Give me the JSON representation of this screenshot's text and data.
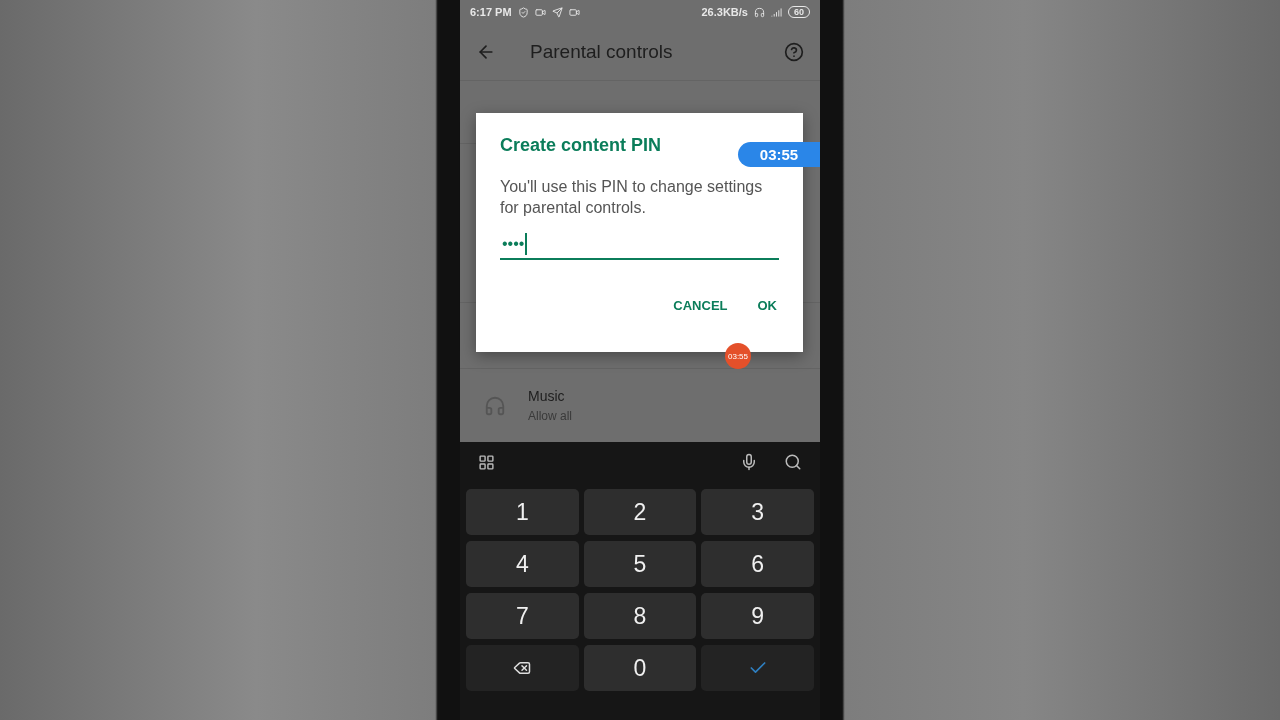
{
  "status_bar": {
    "time": "6:17 PM",
    "speed": "26.3KB/s",
    "battery": "60"
  },
  "app_bar": {
    "title": "Parental controls"
  },
  "list": [
    {
      "title": "Music",
      "subtitle": "Allow all"
    }
  ],
  "dialog": {
    "title": "Create content PIN",
    "message": "You'll use this PIN to change settings for parental controls.",
    "pin_value": "••••",
    "buttons": [
      "CANCEL",
      "OK"
    ]
  },
  "recorder": {
    "timer": "03:55",
    "bubble": "03:55"
  },
  "keyboard": {
    "keys": [
      {
        "kind": "digit",
        "label": "1"
      },
      {
        "kind": "digit",
        "label": "2"
      },
      {
        "kind": "digit",
        "label": "3"
      },
      {
        "kind": "digit",
        "label": "4"
      },
      {
        "kind": "digit",
        "label": "5"
      },
      {
        "kind": "digit",
        "label": "6"
      },
      {
        "kind": "digit",
        "label": "7"
      },
      {
        "kind": "digit",
        "label": "8"
      },
      {
        "kind": "digit",
        "label": "9"
      },
      {
        "kind": "backspace"
      },
      {
        "kind": "digit",
        "label": "0"
      },
      {
        "kind": "enter"
      }
    ]
  }
}
